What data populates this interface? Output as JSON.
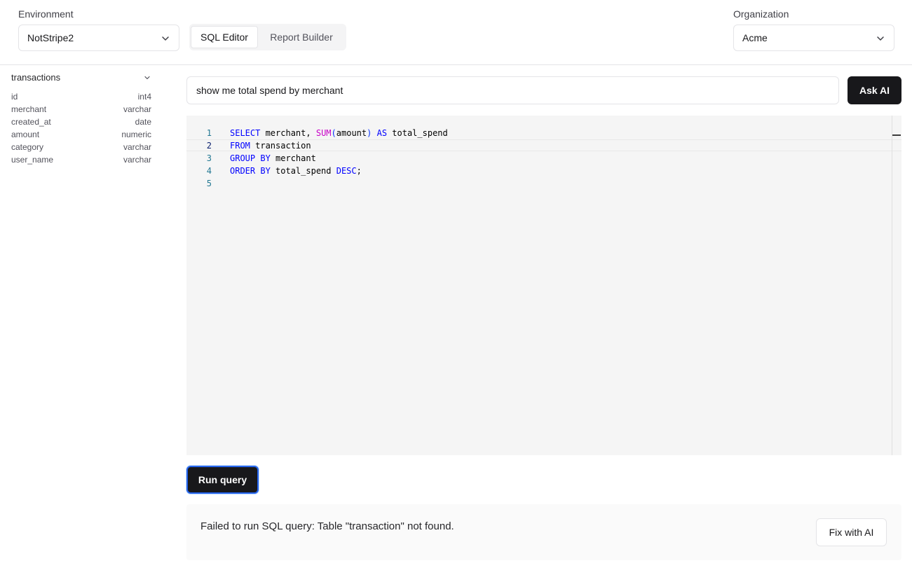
{
  "header": {
    "environment_label": "Environment",
    "environment_value": "NotStripe2",
    "tabs": [
      {
        "label": "SQL Editor",
        "active": true
      },
      {
        "label": "Report Builder",
        "active": false
      }
    ],
    "organization_label": "Organization",
    "organization_value": "Acme"
  },
  "sidebar": {
    "table_name": "transactions",
    "columns": [
      {
        "name": "id",
        "type": "int4"
      },
      {
        "name": "merchant",
        "type": "varchar"
      },
      {
        "name": "created_at",
        "type": "date"
      },
      {
        "name": "amount",
        "type": "numeric"
      },
      {
        "name": "category",
        "type": "varchar"
      },
      {
        "name": "user_name",
        "type": "varchar"
      }
    ]
  },
  "ai": {
    "prompt_value": "show me total spend by merchant",
    "ask_label": "Ask AI"
  },
  "editor": {
    "line_numbers": [
      "1",
      "2",
      "3",
      "4",
      "5"
    ],
    "active_line": 2,
    "lines": [
      {
        "t0": "SELECT",
        "t1": " merchant, ",
        "t2": "SUM",
        "t3": "(",
        "t4": "amount",
        "t5": ")",
        "t6": " ",
        "t7": "AS",
        "t8": " total_spend"
      },
      {
        "t0": "FROM",
        "t1": " transaction"
      },
      {
        "t0": "GROUP BY",
        "t1": " merchant"
      },
      {
        "t0": "ORDER BY",
        "t1": " total_spend ",
        "t2": "DESC",
        "t3": ";"
      }
    ]
  },
  "run_label": "Run query",
  "error": {
    "message": "Failed to run SQL query: Table \"transaction\" not found.",
    "fix_label": "Fix with AI"
  },
  "colors": {
    "primary_button": "#18181b",
    "focus_ring": "#2563eb",
    "sql_keyword": "#0000ff",
    "sql_function": "#c700c7",
    "line_number": "#237893"
  }
}
